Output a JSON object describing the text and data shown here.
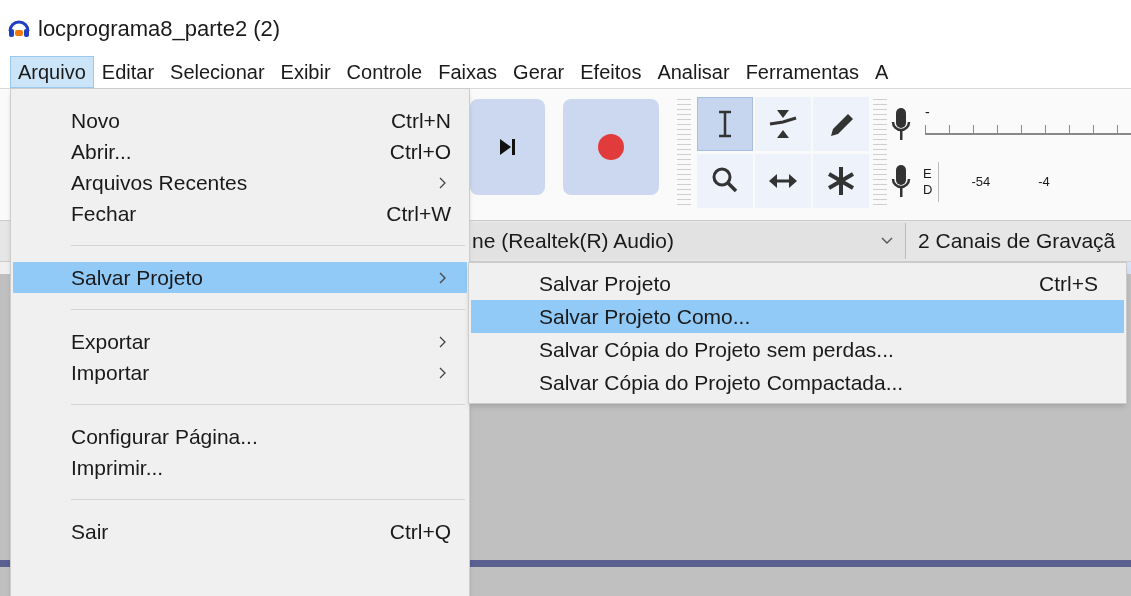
{
  "window": {
    "title": "locprograma8_parte2 (2)"
  },
  "menubar": [
    {
      "label": "Arquivo",
      "selected": true
    },
    {
      "label": "Editar",
      "selected": false
    },
    {
      "label": "Selecionar",
      "selected": false
    },
    {
      "label": "Exibir",
      "selected": false
    },
    {
      "label": "Controle",
      "selected": false
    },
    {
      "label": "Faixas",
      "selected": false
    },
    {
      "label": "Gerar",
      "selected": false
    },
    {
      "label": "Efeitos",
      "selected": false
    },
    {
      "label": "Analisar",
      "selected": false
    },
    {
      "label": "Ferramentas",
      "selected": false
    },
    {
      "label": "A",
      "selected": false
    }
  ],
  "file_menu": [
    {
      "label": "Novo",
      "shortcut": "Ctrl+N",
      "submenu": false,
      "selected": false
    },
    {
      "label": "Abrir...",
      "shortcut": "Ctrl+O",
      "submenu": false,
      "selected": false
    },
    {
      "label": "Arquivos Recentes",
      "submenu": true,
      "selected": false
    },
    {
      "label": "Fechar",
      "shortcut": "Ctrl+W",
      "submenu": false,
      "selected": false
    },
    {
      "kind": "separator"
    },
    {
      "label": "Salvar Projeto",
      "submenu": true,
      "selected": true
    },
    {
      "kind": "separator"
    },
    {
      "label": "Exportar",
      "submenu": true,
      "selected": false
    },
    {
      "label": "Importar",
      "submenu": true,
      "selected": false
    },
    {
      "kind": "separator"
    },
    {
      "label": "Configurar Página...",
      "submenu": false,
      "selected": false
    },
    {
      "label": "Imprimir...",
      "submenu": false,
      "selected": false
    },
    {
      "kind": "separator"
    },
    {
      "label": "Sair",
      "shortcut": "Ctrl+Q",
      "submenu": false,
      "selected": false
    }
  ],
  "save_submenu": [
    {
      "label": "Salvar Projeto",
      "shortcut": "Ctrl+S",
      "selected": false
    },
    {
      "label": "Salvar Projeto Como...",
      "selected": true
    },
    {
      "label": "Salvar Cópia do Projeto sem perdas...",
      "selected": false
    },
    {
      "label": "Salvar Cópia do Projeto Compactada...",
      "selected": false
    }
  ],
  "tools": [
    {
      "kind": "ibeam",
      "selected": true
    },
    {
      "kind": "envelope",
      "selected": false
    },
    {
      "kind": "pencil",
      "selected": false
    },
    {
      "kind": "zoom",
      "selected": false
    },
    {
      "kind": "timeshift",
      "selected": false
    },
    {
      "kind": "multi",
      "selected": false
    }
  ],
  "meters": {
    "top_label": "-",
    "left_label": "E",
    "right_label": "D",
    "ticks": [
      "-54",
      "-4"
    ]
  },
  "device_bar": {
    "input_device": "ne (Realtek(R) Audio)",
    "channels": "2 Canais de  Gravaçã"
  }
}
